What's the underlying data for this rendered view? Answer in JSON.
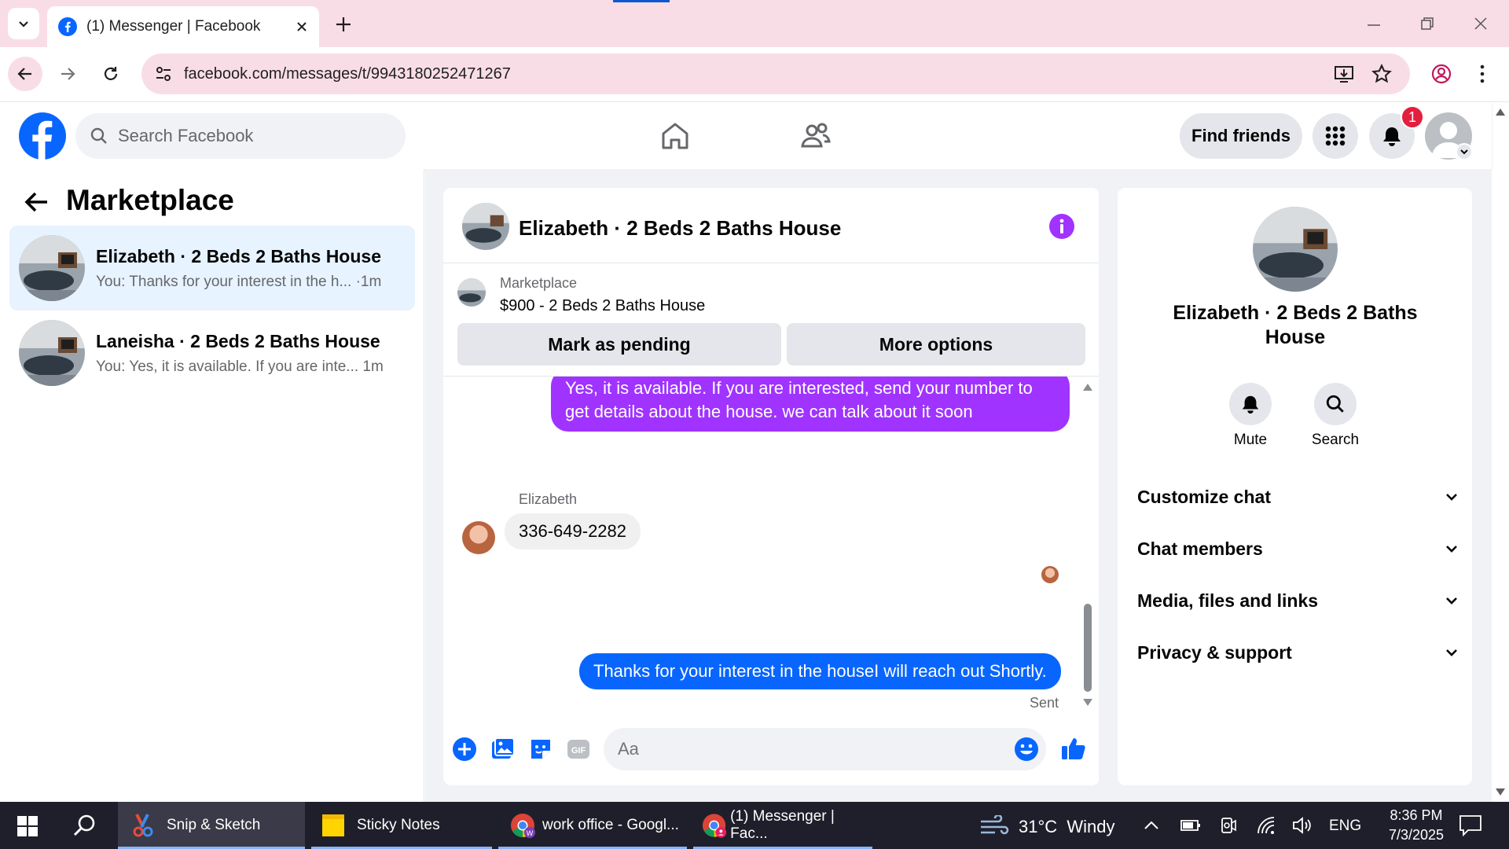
{
  "browser": {
    "tab_title": "(1) Messenger | Facebook",
    "url": "facebook.com/messages/t/9943180252471267"
  },
  "fb": {
    "search_placeholder": "Search Facebook",
    "find_friends": "Find friends",
    "notif_count": "1"
  },
  "sidebar": {
    "title": "Marketplace",
    "conversations": [
      {
        "name": "Elizabeth · 2 Beds 2 Baths House",
        "preview": "You: Thanks for your interest in the h...",
        "time": "·1m"
      },
      {
        "name": "Laneisha · 2 Beds 2 Baths House",
        "preview": "You: Yes, it is available. If you are inte...",
        "time": "1m"
      }
    ]
  },
  "chat": {
    "title": "Elizabeth · 2 Beds 2 Baths House",
    "listing_source": "Marketplace",
    "listing": "$900 - 2 Beds 2 Baths House",
    "mark_pending": "Mark as pending",
    "more_options": "More options",
    "messages": {
      "m1_line1": "Yes, it is available. If you are interested, send your number to",
      "m1_line2": "get details about the house. we can talk about it soon",
      "sender": "Elizabeth",
      "m2": "336-649-2282",
      "m3": "Thanks for your interest in the houseI will reach out Shortly.",
      "status": "Sent"
    },
    "composer_placeholder": "Aa"
  },
  "info": {
    "name": "Elizabeth · 2 Beds 2 Baths House",
    "mute": "Mute",
    "search": "Search",
    "sections": [
      "Customize chat",
      "Chat members",
      "Media, files and links",
      "Privacy & support"
    ]
  },
  "taskbar": {
    "apps": [
      "Snip & Sketch",
      "Sticky Notes",
      "work office - Googl...",
      "(1) Messenger | Fac..."
    ],
    "weather": "31°C  Windy",
    "lang": "ENG",
    "time": "8:36 PM",
    "date": "7/3/2025"
  },
  "colors": {
    "fb_blue": "#0866ff",
    "purple": "#a033ff",
    "chrome_pink": "#f9dde6"
  }
}
